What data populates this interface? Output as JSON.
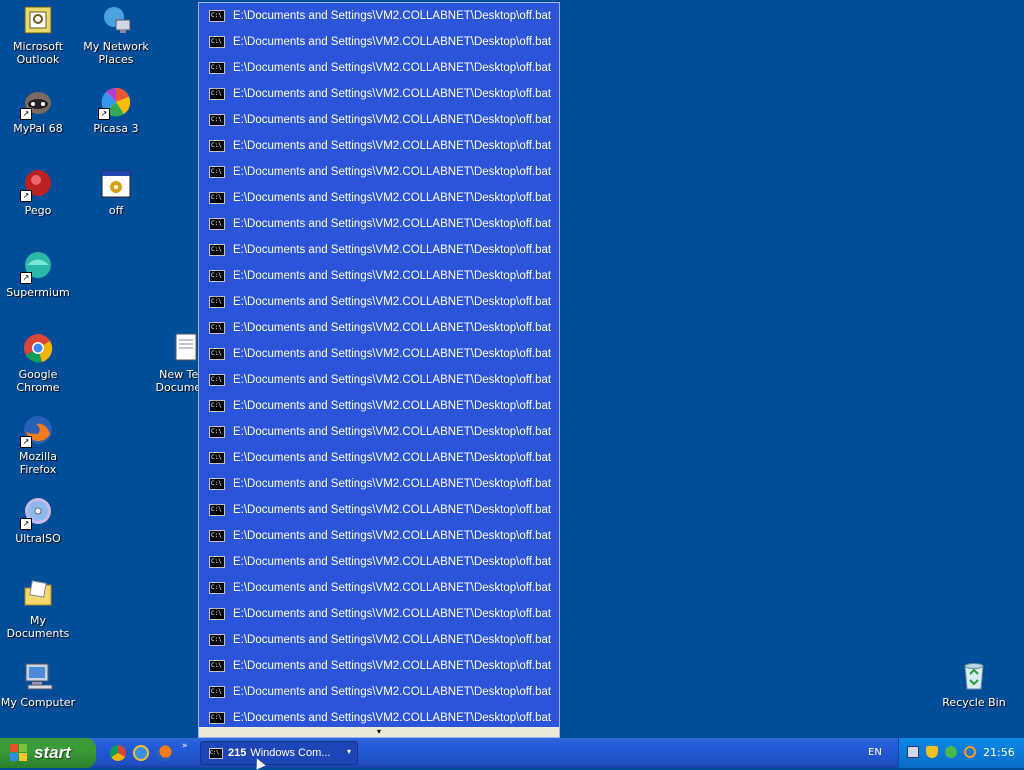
{
  "desktop": {
    "icons": [
      {
        "label": "Microsoft Outlook",
        "icon": "outlook-icon",
        "shortcut": false
      },
      {
        "label": "My Network Places",
        "icon": "network-places-icon",
        "shortcut": false
      },
      {
        "label": "MyPal 68",
        "icon": "mypal-raccoon-icon",
        "shortcut": true
      },
      {
        "label": "Picasa 3",
        "icon": "picasa-icon",
        "shortcut": true
      },
      {
        "label": "Pego",
        "icon": "pego-icon",
        "shortcut": true
      },
      {
        "label": "off",
        "icon": "batch-file-icon",
        "shortcut": false
      },
      {
        "label": "Supermium",
        "icon": "supermium-icon",
        "shortcut": true
      },
      {
        "label": "Google Chrome",
        "icon": "chrome-icon",
        "shortcut": false
      },
      {
        "label": "New Text Document",
        "icon": "text-document-icon",
        "shortcut": false
      },
      {
        "label": "Mozilla Firefox",
        "icon": "firefox-icon",
        "shortcut": true
      },
      {
        "label": "UltraISO",
        "icon": "ultraiso-disc-icon",
        "shortcut": true
      },
      {
        "label": "My Documents",
        "icon": "my-documents-folder-icon",
        "shortcut": false
      },
      {
        "label": "My Computer",
        "icon": "my-computer-icon",
        "shortcut": false
      },
      {
        "label": "Recycle Bin",
        "icon": "recycle-bin-icon",
        "shortcut": false
      }
    ],
    "partial_label": "New T\nDocu"
  },
  "group_popup": {
    "item_icon": "C:\\",
    "items": [
      "E:\\Documents and Settings\\VM2.COLLABNET\\Desktop\\off.bat",
      "E:\\Documents and Settings\\VM2.COLLABNET\\Desktop\\off.bat",
      "E:\\Documents and Settings\\VM2.COLLABNET\\Desktop\\off.bat",
      "E:\\Documents and Settings\\VM2.COLLABNET\\Desktop\\off.bat",
      "E:\\Documents and Settings\\VM2.COLLABNET\\Desktop\\off.bat",
      "E:\\Documents and Settings\\VM2.COLLABNET\\Desktop\\off.bat",
      "E:\\Documents and Settings\\VM2.COLLABNET\\Desktop\\off.bat",
      "E:\\Documents and Settings\\VM2.COLLABNET\\Desktop\\off.bat",
      "E:\\Documents and Settings\\VM2.COLLABNET\\Desktop\\off.bat",
      "E:\\Documents and Settings\\VM2.COLLABNET\\Desktop\\off.bat",
      "E:\\Documents and Settings\\VM2.COLLABNET\\Desktop\\off.bat",
      "E:\\Documents and Settings\\VM2.COLLABNET\\Desktop\\off.bat",
      "E:\\Documents and Settings\\VM2.COLLABNET\\Desktop\\off.bat",
      "E:\\Documents and Settings\\VM2.COLLABNET\\Desktop\\off.bat",
      "E:\\Documents and Settings\\VM2.COLLABNET\\Desktop\\off.bat",
      "E:\\Documents and Settings\\VM2.COLLABNET\\Desktop\\off.bat",
      "E:\\Documents and Settings\\VM2.COLLABNET\\Desktop\\off.bat",
      "E:\\Documents and Settings\\VM2.COLLABNET\\Desktop\\off.bat",
      "E:\\Documents and Settings\\VM2.COLLABNET\\Desktop\\off.bat",
      "E:\\Documents and Settings\\VM2.COLLABNET\\Desktop\\off.bat",
      "E:\\Documents and Settings\\VM2.COLLABNET\\Desktop\\off.bat",
      "E:\\Documents and Settings\\VM2.COLLABNET\\Desktop\\off.bat",
      "E:\\Documents and Settings\\VM2.COLLABNET\\Desktop\\off.bat",
      "E:\\Documents and Settings\\VM2.COLLABNET\\Desktop\\off.bat",
      "E:\\Documents and Settings\\VM2.COLLABNET\\Desktop\\off.bat",
      "E:\\Documents and Settings\\VM2.COLLABNET\\Desktop\\off.bat",
      "E:\\Documents and Settings\\VM2.COLLABNET\\Desktop\\off.bat",
      "E:\\Documents and Settings\\VM2.COLLABNET\\Desktop\\off.bat"
    ],
    "scroll_more_icon": "chevron-down-icon"
  },
  "taskbar": {
    "start_label": "start",
    "quick_launch": [
      "chrome-icon",
      "internet-explorer-icon",
      "firefox-icon"
    ],
    "quick_launch_more": "»",
    "group_button": {
      "count": "215",
      "label": "Windows Com...",
      "arrow": "▾"
    },
    "language": "EN",
    "tray_icons": [
      "network-icon",
      "security-shield-icon",
      "update-icon",
      "search-icon"
    ],
    "clock": "21:56"
  },
  "colors": {
    "desktop_bg": "#004e98",
    "popup_bg": "#2b54d8",
    "taskbar_blue": "#245edb",
    "start_green": "#3a9b38",
    "tray_blue": "#0b7dd8"
  }
}
